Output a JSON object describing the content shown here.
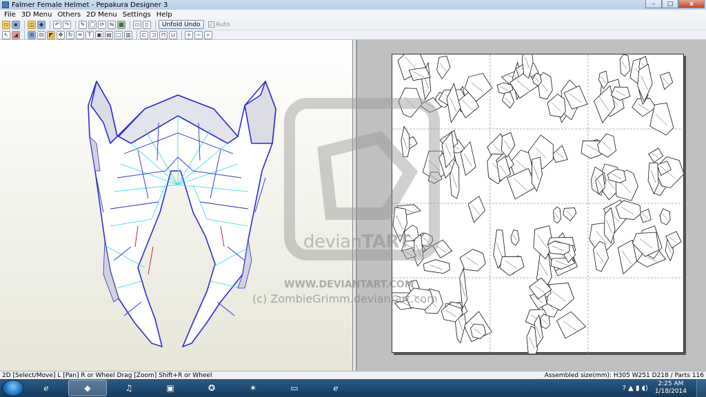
{
  "window": {
    "title": "Falmer Female Helmet - Pepakura Designer 3",
    "minimize": "–",
    "maximize": "□",
    "close": "x"
  },
  "menu": [
    "File",
    "3D Menu",
    "Others",
    "2D Menu",
    "Settings",
    "Help"
  ],
  "toolbar": {
    "unfold_undo": "Unfold Undo",
    "auto_label": "Auto",
    "auto_checked": true
  },
  "watermark": {
    "brand_light": "devian",
    "brand_bold": "TART",
    "url": "WWW.DEVIANTART.COM",
    "copyright": "(c) ZombieGrimm.deviantart.com"
  },
  "status": {
    "left": "2D [Select/Move] L [Pan] R or Wheel Drag [Zoom] Shift+R or Wheel",
    "right": "Assembled size(mm): H305 W251 D218 / Parts 116"
  },
  "taskbar": {
    "time": "2:25 AM",
    "date": "1/18/2014"
  },
  "colors": {
    "accent_edge": "#2a2ad8",
    "mountain_fold": "#2ad8e0",
    "valley_fold": "#c8204a",
    "background_3d": "#f4f3ea",
    "background_2d": "#c0c0c0"
  }
}
